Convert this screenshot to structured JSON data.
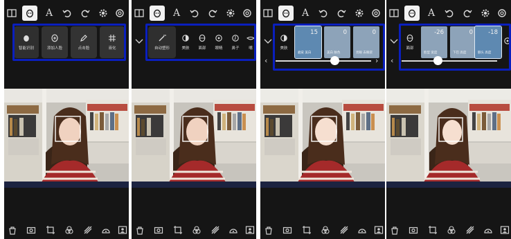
{
  "panels": {
    "p1": {
      "tools": [
        {
          "label": "智能识别",
          "icon": "face-outline-icon"
        },
        {
          "label": "添加人脸",
          "icon": "add-face-icon"
        },
        {
          "label": "点击脸",
          "icon": "pencil-icon"
        },
        {
          "label": "液化",
          "icon": "grid-icon"
        }
      ]
    },
    "p2": {
      "tools": [
        {
          "label": "自动塑形",
          "icon": "magic-wand-icon"
        },
        {
          "label": "美肤",
          "icon": "contrast-icon"
        },
        {
          "label": "面部",
          "icon": "face-contour-icon"
        },
        {
          "label": "眼睛",
          "icon": "eye-icon"
        },
        {
          "label": "鼻子",
          "icon": "nose-icon"
        },
        {
          "label": "嘴",
          "icon": "mouth-icon"
        }
      ]
    },
    "p3": {
      "lead_label": "美肤",
      "values": [
        {
          "num": "15",
          "label": "磨皮 美白"
        },
        {
          "num": "0",
          "label": "美白 肤色"
        },
        {
          "num": "0",
          "label": "亮眼 去眼袋"
        }
      ],
      "slider_level": 0.62
    },
    "p4": {
      "lead_label": "面部",
      "values": [
        {
          "num": "-26",
          "label": "脸型 宽度"
        },
        {
          "num": "0",
          "label": "下巴 高度"
        },
        {
          "num": "-18",
          "label": "额头 高度"
        }
      ],
      "slider_level": 0.38
    }
  },
  "colors": {
    "panel_bg": "#151515",
    "highlight": "#0a1fbe",
    "value_tile": "#8da3b9",
    "value_tile_active": "#5e89b1"
  }
}
